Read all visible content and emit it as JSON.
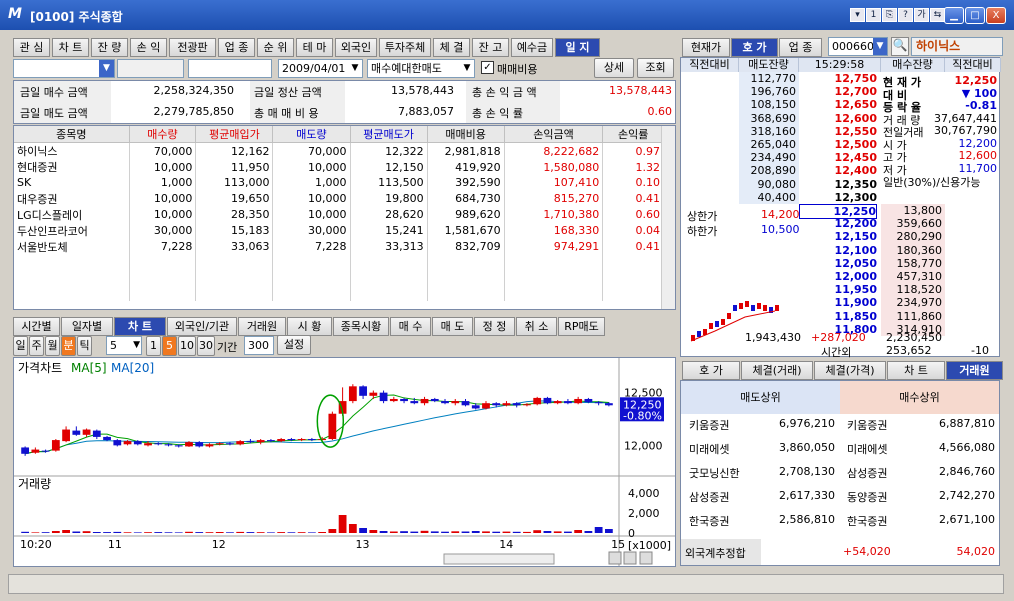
{
  "window": {
    "title": "[0100] 주식종합",
    "logo": "M",
    "tool_icons": [
      "▾",
      "1",
      "⎘",
      "?",
      "가",
      "⇆"
    ],
    "min": "▁",
    "max": "□",
    "close": "X"
  },
  "top_tabs": [
    "관 심",
    "차 트",
    "잔 량",
    "손 익",
    "전광판",
    "업 종",
    "순 위",
    "테 마",
    "외국인",
    "투자주체",
    "체 결",
    "잔 고",
    "예수금",
    "일 지"
  ],
  "top_tab_selected": 13,
  "account": {
    "field1": "",
    "field2": "",
    "field3": "",
    "date": "2009/04/01",
    "filter": "매수예대한매도",
    "checkbox_label": "매매비용",
    "checked": true,
    "detail_btn": "상세",
    "query_btn": "조회"
  },
  "summary": {
    "buy_label": "금일 매수 금액",
    "buy_value": "2,258,324,350",
    "settle_label": "금일 정산 금액",
    "settle_value": "13,578,443",
    "total_pl_label": "총 손 익 금 액",
    "total_pl_value": "13,578,443",
    "sell_label": "금일 매도 금액",
    "sell_value": "2,279,785,850",
    "fee_label": "총 매 매 비 용",
    "fee_value": "7,883,057",
    "rate_label": "총 손 익 률",
    "rate_value": "0.60"
  },
  "holdings": {
    "headers": [
      "종목명",
      "매수량",
      "평균매입가",
      "매도량",
      "평균매도가",
      "매매비용",
      "손익금액",
      "손익률"
    ],
    "rows": [
      [
        "하이닉스",
        "70,000",
        "12,162",
        "70,000",
        "12,322",
        "2,981,818",
        "8,222,682",
        "0.97"
      ],
      [
        "현대증권",
        "10,000",
        "11,950",
        "10,000",
        "12,150",
        "419,920",
        "1,580,080",
        "1.32"
      ],
      [
        "SK",
        "1,000",
        "113,000",
        "1,000",
        "113,500",
        "392,590",
        "107,410",
        "0.10"
      ],
      [
        "대우증권",
        "10,000",
        "19,650",
        "10,000",
        "19,800",
        "684,730",
        "815,270",
        "0.41"
      ],
      [
        "LG디스플레이",
        "10,000",
        "28,350",
        "10,000",
        "28,620",
        "989,620",
        "1,710,380",
        "0.60"
      ],
      [
        "두산인프라코어",
        "30,000",
        "15,183",
        "30,000",
        "15,241",
        "1,581,670",
        "168,330",
        "0.04"
      ],
      [
        "서울반도체",
        "7,228",
        "33,063",
        "7,228",
        "33,313",
        "832,709",
        "974,291",
        "0.41"
      ]
    ]
  },
  "bottom_tabs": [
    "시간별",
    "일자별",
    "차 트",
    "외국인/기관",
    "거래원",
    "시 황",
    "종목시황",
    "매 수",
    "매 도",
    "정 정",
    "취 소",
    "RP매도"
  ],
  "bottom_tab_selected": 2,
  "chart_toolbar": {
    "periods": [
      "일",
      "주",
      "월",
      "분",
      "틱"
    ],
    "period_selected": 3,
    "interval": "5",
    "units": [
      "1",
      "5",
      "10",
      "30"
    ],
    "unit_selected": 1,
    "range_label": "기간",
    "range_value": "300",
    "settings": "설정"
  },
  "chart_data": {
    "type": "candlestick",
    "title": "가격차트",
    "ma_labels": [
      "MA[5]",
      "MA[20]"
    ],
    "volume_title": "거래량",
    "price_ticks": [
      "12,500",
      "12,000"
    ],
    "volume_ticks": [
      "4,000",
      "2,000",
      "0",
      "[x1000]"
    ],
    "x_ticks": [
      "10:20",
      "11",
      "12",
      "13",
      "14",
      "15"
    ],
    "last_price": "12,250",
    "last_change": "-0.80%",
    "candles": [
      [
        11980,
        11920,
        11990,
        11900
      ],
      [
        11930,
        11960,
        11980,
        11920
      ],
      [
        11950,
        11940,
        11960,
        11930
      ],
      [
        11950,
        12050,
        12060,
        11940
      ],
      [
        12040,
        12150,
        12180,
        12030
      ],
      [
        12140,
        12100,
        12180,
        12090
      ],
      [
        12100,
        12150,
        12160,
        12080
      ],
      [
        12140,
        12080,
        12150,
        12060
      ],
      [
        12080,
        12050,
        12090,
        12040
      ],
      [
        12050,
        12000,
        12060,
        11990
      ],
      [
        12010,
        12040,
        12050,
        12000
      ],
      [
        12040,
        12010,
        12050,
        12000
      ],
      [
        12000,
        12020,
        12040,
        11990
      ],
      [
        12020,
        12010,
        12030,
        12000
      ],
      [
        12010,
        12000,
        12020,
        11990
      ],
      [
        12000,
        11990,
        12010,
        11980
      ],
      [
        11990,
        12030,
        12040,
        11985
      ],
      [
        12030,
        11990,
        12040,
        11980
      ],
      [
        11990,
        12010,
        12020,
        11980
      ],
      [
        12010,
        12020,
        12030,
        12000
      ],
      [
        12020,
        12010,
        12030,
        12000
      ],
      [
        12010,
        12040,
        12050,
        12000
      ],
      [
        12040,
        12030,
        12060,
        12020
      ],
      [
        12030,
        12050,
        12060,
        12010
      ],
      [
        12050,
        12040,
        12060,
        12030
      ],
      [
        12040,
        12060,
        12070,
        12030
      ],
      [
        12060,
        12050,
        12070,
        12040
      ],
      [
        12050,
        12060,
        12070,
        12040
      ],
      [
        12060,
        12050,
        12070,
        12040
      ],
      [
        12050,
        12060,
        12080,
        12040
      ],
      [
        12060,
        12300,
        12320,
        12050
      ],
      [
        12300,
        12420,
        12550,
        12280
      ],
      [
        12420,
        12560,
        12580,
        12400
      ],
      [
        12560,
        12470,
        12570,
        12440
      ],
      [
        12470,
        12500,
        12520,
        12440
      ],
      [
        12500,
        12420,
        12520,
        12400
      ],
      [
        12420,
        12440,
        12460,
        12410
      ],
      [
        12440,
        12420,
        12450,
        12400
      ],
      [
        12420,
        12400,
        12450,
        12390
      ],
      [
        12400,
        12440,
        12460,
        12380
      ],
      [
        12440,
        12420,
        12450,
        12410
      ],
      [
        12420,
        12400,
        12440,
        12390
      ],
      [
        12400,
        12420,
        12440,
        12380
      ],
      [
        12420,
        12380,
        12440,
        12370
      ],
      [
        12380,
        12350,
        12400,
        12340
      ],
      [
        12350,
        12400,
        12420,
        12340
      ],
      [
        12400,
        12380,
        12410,
        12360
      ],
      [
        12380,
        12400,
        12420,
        12370
      ],
      [
        12400,
        12380,
        12410,
        12360
      ],
      [
        12380,
        12390,
        12400,
        12370
      ],
      [
        12390,
        12450,
        12460,
        12380
      ],
      [
        12450,
        12400,
        12460,
        12390
      ],
      [
        12400,
        12420,
        12430,
        12390
      ],
      [
        12420,
        12400,
        12440,
        12390
      ],
      [
        12400,
        12440,
        12460,
        12390
      ],
      [
        12440,
        12410,
        12450,
        12400
      ],
      [
        12410,
        12400,
        12420,
        12380
      ],
      [
        12400,
        12380,
        12410,
        12370
      ]
    ],
    "volumes": [
      120,
      60,
      80,
      200,
      300,
      150,
      180,
      100,
      90,
      110,
      70,
      60,
      80,
      90,
      70,
      60,
      120,
      90,
      80,
      100,
      70,
      110,
      90,
      80,
      60,
      90,
      70,
      80,
      60,
      100,
      400,
      1800,
      900,
      500,
      300,
      200,
      150,
      180,
      140,
      220,
      160,
      130,
      170,
      150,
      200,
      160,
      130,
      140,
      120,
      110,
      280,
      200,
      160,
      140,
      300,
      200,
      600,
      400
    ]
  },
  "orderbook": {
    "tabs": [
      "현재가",
      "호 가",
      "업 종"
    ],
    "tab_selected": 1,
    "code": "000660",
    "stock_name": "하이닉스",
    "head": [
      "직전대비",
      "매도잔량",
      "15:29:58",
      "매수잔량",
      "직전대비"
    ],
    "asks": [
      [
        "112,770",
        "12,750"
      ],
      [
        "196,760",
        "12,700"
      ],
      [
        "108,150",
        "12,650"
      ],
      [
        "368,690",
        "12,600"
      ],
      [
        "318,160",
        "12,550"
      ],
      [
        "265,040",
        "12,500"
      ],
      [
        "234,490",
        "12,450"
      ],
      [
        "208,890",
        "12,400"
      ],
      [
        "90,080",
        "12,350"
      ],
      [
        "40,400",
        "12,300"
      ]
    ],
    "bids": [
      [
        "12,250",
        "13,800"
      ],
      [
        "12,200",
        "359,660"
      ],
      [
        "12,150",
        "280,290"
      ],
      [
        "12,100",
        "180,360"
      ],
      [
        "12,050",
        "158,770"
      ],
      [
        "12,000",
        "457,310"
      ],
      [
        "11,950",
        "118,520"
      ],
      [
        "11,900",
        "234,970"
      ],
      [
        "11,850",
        "111,860"
      ],
      [
        "11,800",
        "314,910"
      ]
    ],
    "info": [
      [
        "현 재 가",
        "12,250"
      ],
      [
        "대    비",
        "▼  100"
      ],
      [
        "등 락 율",
        "-0.81"
      ],
      [
        "거 래 량",
        "37,647,441"
      ],
      [
        "전일거래",
        "30,767,790"
      ],
      [
        "시    가",
        "12,200"
      ],
      [
        "고    가",
        "12,600"
      ],
      [
        "저    가",
        "11,700"
      ],
      [
        "일반(30%)/신용가능",
        ""
      ]
    ],
    "upper_label": "상한가",
    "upper_value": "14,200",
    "lower_label": "하한가",
    "lower_value": "10,500",
    "total_ask": "1,943,430",
    "total_diff": "+287,020",
    "total_bid": "2,230,450",
    "after_label": "시간외",
    "after_bid": "253,652",
    "after_diff": "-10"
  },
  "broker": {
    "tabs": [
      "호 가",
      "체결(거래)",
      "체결(가격)",
      "차 트",
      "거래원"
    ],
    "tab_selected": 4,
    "sell_head": "매도상위",
    "buy_head": "매수상위",
    "rows": [
      [
        "키움증권",
        "6,976,210",
        "키움증권",
        "6,887,810"
      ],
      [
        "미래에셋",
        "3,860,050",
        "미래에셋",
        "4,566,080"
      ],
      [
        "굿모닝신한",
        "2,708,130",
        "삼성증권",
        "2,846,760"
      ],
      [
        "삼성증권",
        "2,617,330",
        "동양증권",
        "2,742,270"
      ],
      [
        "한국증권",
        "2,586,810",
        "한국증권",
        "2,671,100"
      ]
    ],
    "foreign_label": "외국계추정합",
    "foreign_diff": "+54,020",
    "foreign_value": "54,020"
  },
  "colors": {
    "up": "#e00000",
    "down": "#0000d0",
    "accent": "#2c4ab0"
  }
}
